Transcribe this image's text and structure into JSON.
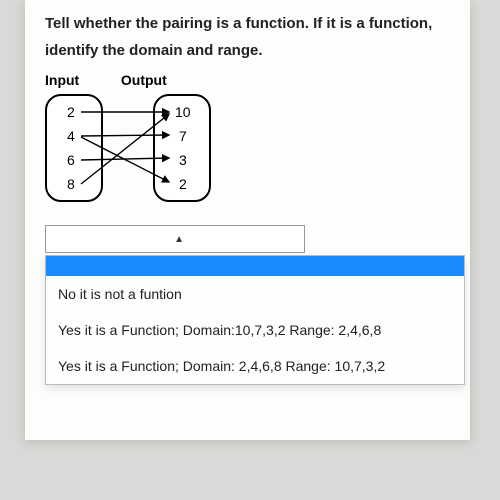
{
  "question": {
    "line1": "Tell whether the pairing is a function. If it is a function,",
    "line2": "identify the domain and range."
  },
  "labels": {
    "input": "Input",
    "output": "Output"
  },
  "mapping": {
    "inputs": [
      "2",
      "4",
      "6",
      "8"
    ],
    "outputs": [
      "10",
      "7",
      "3",
      "2"
    ]
  },
  "dropdown": {
    "caret": "▲",
    "options": [
      "",
      "No it is not a funtion",
      "Yes it is a Function; Domain:10,7,3,2 Range: 2,4,6,8",
      "Yes it is a Function; Domain: 2,4,6,8 Range: 10,7,3,2"
    ]
  }
}
